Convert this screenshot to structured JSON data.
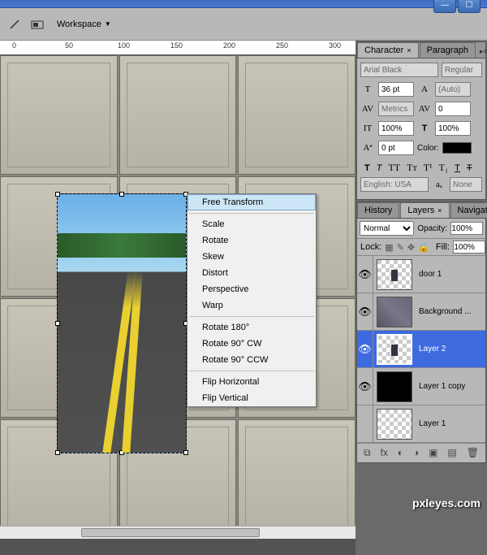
{
  "toolbar": {
    "workspace_label": "Workspace"
  },
  "context_menu": {
    "items": [
      {
        "label": "Free Transform",
        "selected": true
      },
      {
        "sep": true
      },
      {
        "label": "Scale"
      },
      {
        "label": "Rotate"
      },
      {
        "label": "Skew"
      },
      {
        "label": "Distort"
      },
      {
        "label": "Perspective"
      },
      {
        "label": "Warp"
      },
      {
        "sep": true
      },
      {
        "label": "Rotate 180°"
      },
      {
        "label": "Rotate 90° CW"
      },
      {
        "label": "Rotate 90° CCW"
      },
      {
        "sep": true
      },
      {
        "label": "Flip Horizontal"
      },
      {
        "label": "Flip Vertical"
      }
    ]
  },
  "character_panel": {
    "tabs": {
      "character": "Character",
      "paragraph": "Paragraph"
    },
    "font_family": "Arial Black",
    "font_style": "Regular",
    "font_size": "36 pt",
    "leading": "(Auto)",
    "kerning": "Metrics",
    "tracking": "0",
    "vscale": "100%",
    "hscale": "100%",
    "baseline": "0 pt",
    "color_label": "Color:",
    "language": "English: USA",
    "aa": "None"
  },
  "layers_panel": {
    "tabs": {
      "history": "History",
      "layers": "Layers",
      "navigator": "Navigator"
    },
    "blend_mode": "Normal",
    "opacity_label": "Opacity:",
    "opacity_value": "100%",
    "lock_label": "Lock:",
    "fill_label": "Fill:",
    "fill_value": "100%",
    "layers": [
      {
        "name": "door 1",
        "visible": true,
        "thumb": "checker-mini"
      },
      {
        "name": "Background ...",
        "visible": true,
        "thumb": "bg"
      },
      {
        "name": "Layer 2",
        "visible": true,
        "thumb": "checker-mini",
        "selected": true
      },
      {
        "name": "Layer 1 copy",
        "visible": true,
        "thumb": "black"
      },
      {
        "name": "Layer 1",
        "visible": false,
        "thumb": "checker"
      }
    ]
  },
  "ruler_numbers": [
    "0",
    "50",
    "100",
    "150",
    "200",
    "250",
    "300"
  ],
  "watermark": "pxleyes.com"
}
